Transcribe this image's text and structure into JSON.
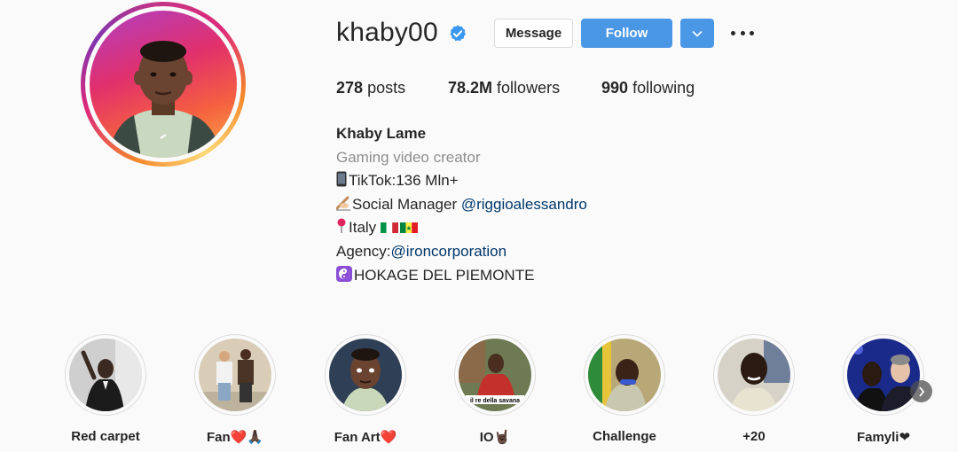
{
  "profile": {
    "username": "khaby00",
    "message_label": "Message",
    "follow_label": "Follow",
    "stats": {
      "posts_count": "278",
      "posts_label": "posts",
      "followers_count": "78.2M",
      "followers_label": "followers",
      "following_count": "990",
      "following_label": "following"
    },
    "bio": {
      "name": "Khaby Lame",
      "category": "Gaming video creator",
      "line1": "TikTok:136 Mln+",
      "line2_text": "Social Manager ",
      "line2_mention": "@riggioalessandro",
      "line3": "Italy",
      "line4_text": "Agency:",
      "line4_mention": "@ironcorporation",
      "line5": "HOKAGE DEL PIEMONTE"
    }
  },
  "highlights": [
    {
      "label": "Red carpet"
    },
    {
      "label": "Fan❤️🙏🏿"
    },
    {
      "label": "Fan Art❤️"
    },
    {
      "label": "IO🤘🏿"
    },
    {
      "label": "Challenge"
    },
    {
      "label": "+20"
    },
    {
      "label": "Famyli❤"
    }
  ],
  "highlight_caption_overlay": "il re della savana",
  "colors": {
    "follow_blue": "#4a97e6",
    "mention": "#00376b",
    "category_gray": "#8e8e8e",
    "verified_blue": "#3897f0"
  },
  "icons": [
    "verified-badge-icon",
    "chevron-down-icon",
    "more-options-icon",
    "phone-emoji-icon",
    "writing-hand-emoji-icon",
    "pin-emoji-icon",
    "yin-yang-emoji-icon",
    "chevron-right-icon"
  ]
}
